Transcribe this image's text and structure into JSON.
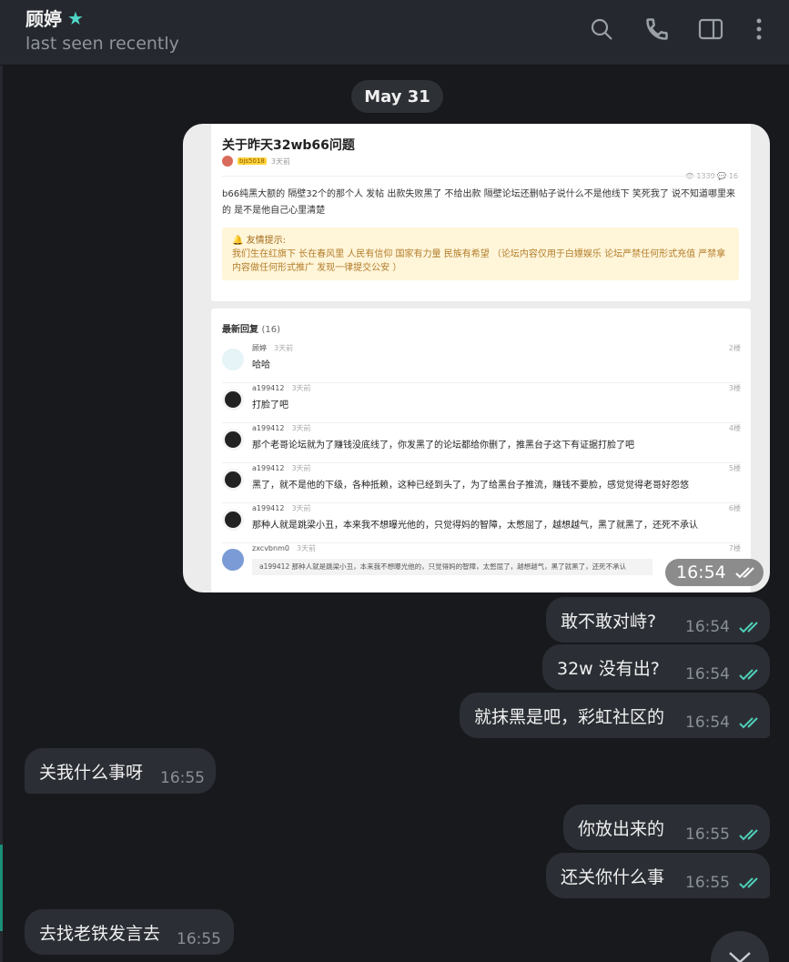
{
  "header": {
    "title": "顾婷",
    "status": "last seen recently"
  },
  "date_separator": "May 31",
  "image_message": {
    "time": "16:54",
    "post": {
      "title": "关于昨天32wb66问题",
      "user_tag": "bjs5018",
      "posted": "3天前",
      "stats": "👁 1339  💬 16",
      "body": "b66纯黑大额的 隔壁32个的那个人 发帖 出款失败黑了 不给出款 隔壁论坛还删帖子说什么不是他线下 笑死我了 说不知道哪里来的 是不是他自己心里清楚",
      "notice_title": "🔔 友情提示:",
      "notice_text": "我们生在红旗下 长在春风里 人民有信仰 国家有力量 民族有希望 （论坛内容仅用于白嫖娱乐 论坛严禁任何形式充值 严禁拿内容做任何形式推广 发现一律提交公安 ）"
    },
    "replies_title": "最新回复",
    "replies_count": "(16)",
    "replies": [
      {
        "name": "顾婷",
        "time": "3天前",
        "floor": "2楼",
        "text": "哈哈"
      },
      {
        "name": "a199412",
        "time": "3天前",
        "floor": "3楼",
        "text": "打脸了吧"
      },
      {
        "name": "a199412",
        "time": "3天前",
        "floor": "4楼",
        "text": "那个老哥论坛就为了赚钱没底线了，你发黑了的论坛都给你删了，推黑台子这下有证据打脸了吧"
      },
      {
        "name": "a199412",
        "time": "3天前",
        "floor": "5楼",
        "text": "黑了，就不是他的下级，各种抵赖，这种已经到头了，为了给黑台子推流，赚钱不要脸，感觉觉得老哥好怨悠"
      },
      {
        "name": "a199412",
        "time": "3天前",
        "floor": "6楼",
        "text": "那种人就是跳梁小丑，本来我不想曝光他的，只觉得妈的智障，太憋屈了，越想越气，黑了就黑了，还死不承认"
      },
      {
        "name": "zxcvbnm0",
        "time": "3天前",
        "floor": "7楼",
        "quote": "a199412    那种人就是跳梁小丑，本来我不想曝光他的，只觉得妈的智障，太憋屈了，越想越气，黑了就黑了，还死不承认"
      }
    ]
  },
  "messages": [
    {
      "dir": "out",
      "text": "敢不敢对峙?",
      "time": "16:54"
    },
    {
      "dir": "out",
      "text": "32w 没有出?",
      "time": "16:54"
    },
    {
      "dir": "out",
      "text": "就抹黑是吧，彩虹社区的",
      "time": "16:54"
    },
    {
      "dir": "in",
      "text": "关我什么事呀",
      "time": "16:55"
    },
    {
      "dir": "out",
      "text": "你放出来的",
      "time": "16:55"
    },
    {
      "dir": "out",
      "text": "还关你什么事",
      "time": "16:55"
    },
    {
      "dir": "in",
      "text": "去找老铁发言去",
      "time": "16:55"
    }
  ],
  "colors": {
    "background": "#18191d",
    "header": "#25282e",
    "bubble": "#2b2f35",
    "accent": "#4fcfb6"
  }
}
